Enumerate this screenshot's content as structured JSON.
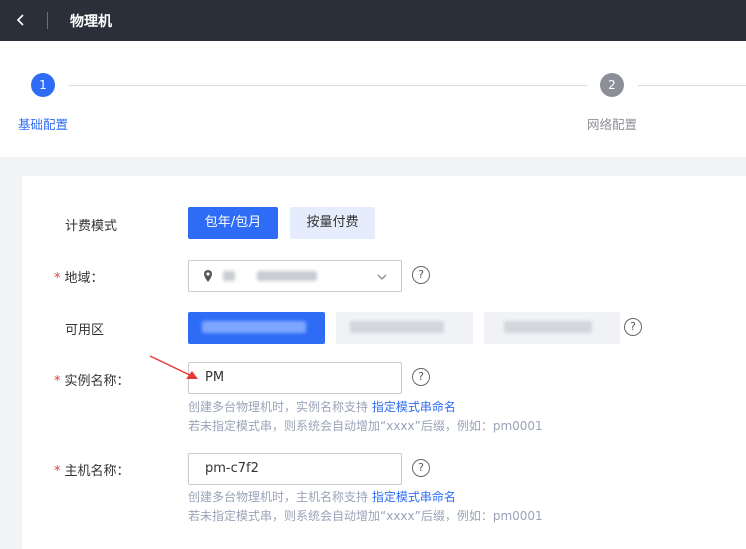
{
  "header": {
    "title": "物理机"
  },
  "steps": [
    {
      "number": "1",
      "label": "基础配置"
    },
    {
      "number": "2",
      "label": "网络配置"
    }
  ],
  "form": {
    "billing": {
      "label": "计费模式",
      "options": [
        "包年/包月",
        "按量付费"
      ]
    },
    "region": {
      "label": "地域：",
      "required_mark": "*"
    },
    "zone": {
      "label": "可用区"
    },
    "instance_name": {
      "label": "实例名称：",
      "required_mark": "*",
      "value": "PM",
      "hint1_prefix": "创建多台物理机时，实例名称支持",
      "hint1_link": "指定模式串命名",
      "hint2": "若未指定模式串，则系统会自动增加“xxxx”后缀，例如：pm0001"
    },
    "host_name": {
      "label": "主机名称：",
      "required_mark": "*",
      "value": "pm-c7f2",
      "hint1_prefix": "创建多台物理机时，主机名称支持",
      "hint1_link": "指定模式串命名",
      "hint2": "若未指定模式串，则系统会自动增加“xxxx”后缀，例如：pm0001"
    },
    "help_symbol": "?"
  },
  "colors": {
    "accent": "#2f6cf6",
    "header_bg": "#2b2f3a",
    "required": "#e53935",
    "annotation_arrow": "#e53935"
  }
}
